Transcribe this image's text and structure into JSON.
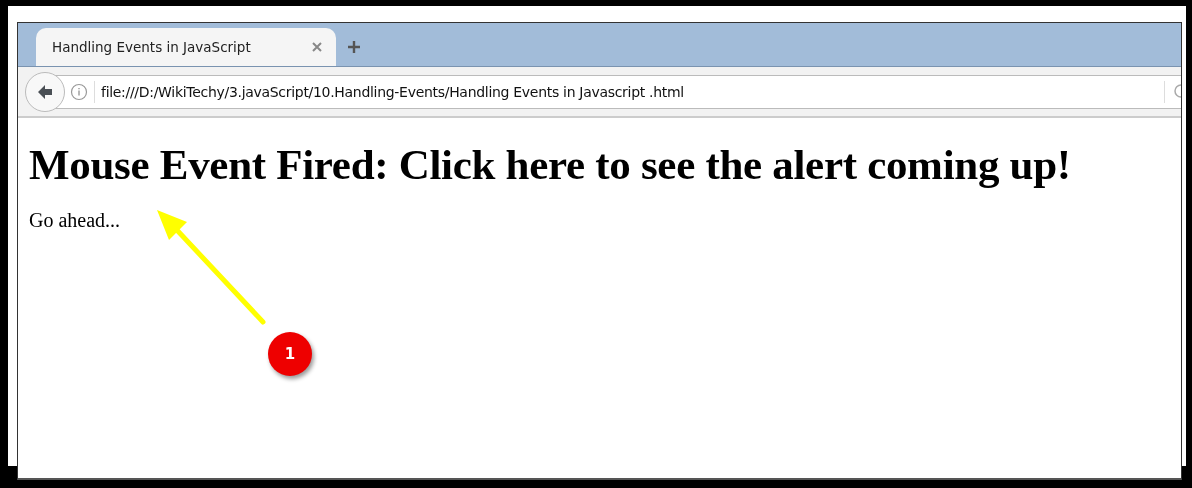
{
  "tabs": [
    {
      "title": "Handling Events in JavaScript",
      "selected": true
    }
  ],
  "address_bar": {
    "url": "file:///D:/WikiTechy/3.javaScript/10.Handling-Events/Handling Events in Javascript .html"
  },
  "page": {
    "heading": "Mouse Event Fired: Click here to see the alert coming up!",
    "paragraph": "Go ahead..."
  },
  "annotation": {
    "number": "1"
  }
}
